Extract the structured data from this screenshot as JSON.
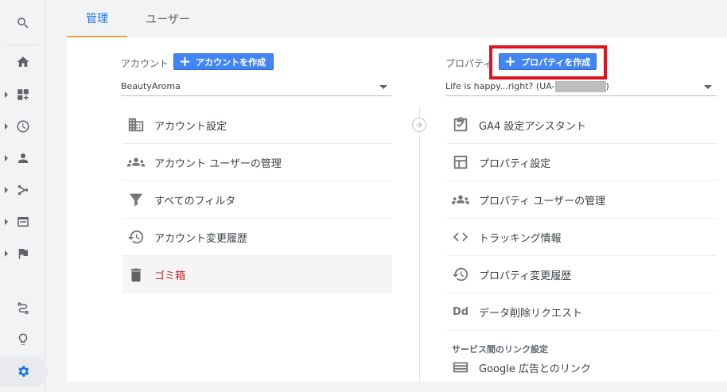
{
  "tabs": {
    "admin": "管理",
    "user": "ユーザー"
  },
  "account": {
    "label": "アカウント",
    "create_button": "アカウントを作成",
    "selected": "BeautyAroma",
    "items": [
      {
        "label": "アカウント設定",
        "icon": "building-icon"
      },
      {
        "label": "アカウント ユーザーの管理",
        "icon": "people-icon"
      },
      {
        "label": "すべてのフィルタ",
        "icon": "filter-icon"
      },
      {
        "label": "アカウント変更履歴",
        "icon": "history-icon"
      },
      {
        "label": "ゴミ箱",
        "icon": "trash-icon"
      }
    ]
  },
  "property": {
    "label": "プロパティ",
    "create_button": "プロパティを作成",
    "selected_prefix": "Life is happy...right? (UA-",
    "selected_suffix": ")",
    "items": [
      {
        "label": "GA4 設定アシスタント",
        "icon": "clipboard-check-icon"
      },
      {
        "label": "プロパティ設定",
        "icon": "layout-icon"
      },
      {
        "label": "プロパティ ユーザーの管理",
        "icon": "people-icon"
      },
      {
        "label": "トラッキング情報",
        "icon": "code-icon"
      },
      {
        "label": "プロパティ変更履歴",
        "icon": "history-icon"
      },
      {
        "label": "データ削除リクエスト",
        "icon": "dd-icon",
        "icon_text": "Dd"
      }
    ],
    "section_title": "サービス間のリンク設定",
    "link_items": [
      {
        "label": "Google 広告とのリンク",
        "icon": "ads-icon"
      }
    ]
  },
  "colors": {
    "accent": "#1a73e8",
    "button": "#4285f4",
    "highlight": "#e0141e",
    "tab_underline": "#e8a33d",
    "trash_text": "#c5221f"
  }
}
